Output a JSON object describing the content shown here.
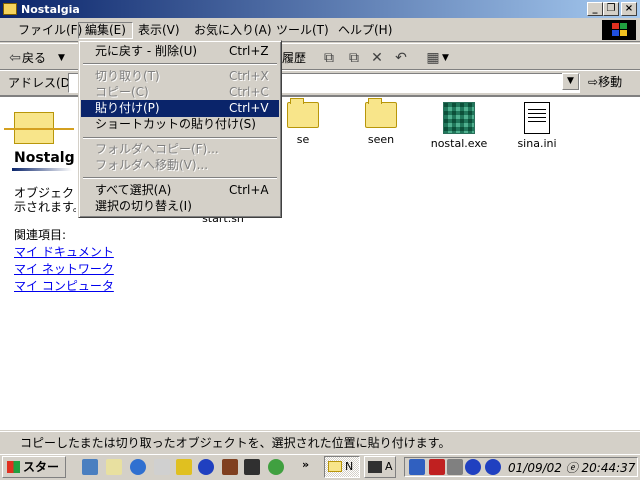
{
  "window": {
    "title": "Nostalgia"
  },
  "menubar": [
    "ファイル(F)",
    "編集(E)",
    "表示(V)",
    "お気に入り(A)",
    "ツール(T)",
    "ヘルプ(H)"
  ],
  "toolbar": {
    "back_label": "戻る",
    "history_label": "履歴"
  },
  "address": {
    "label": "アドレス(D)",
    "go_label": "移動"
  },
  "left_panel": {
    "folder_name": "Nostalg",
    "description": [
      "オブジェクトを",
      "示されます。"
    ],
    "related_label": "関連項目:",
    "links": [
      "マイ ドキュメント",
      "マイ ネットワーク",
      "マイ コンピュータ"
    ]
  },
  "files": [
    {
      "name": "se",
      "type": "folder"
    },
    {
      "name": "seen",
      "type": "folder"
    },
    {
      "name": "nostal.exe",
      "type": "exe"
    },
    {
      "name": "sina.ini",
      "type": "ini"
    },
    {
      "name": "start.sh",
      "type": "partial"
    }
  ],
  "edit_menu": [
    {
      "label": "元に戻す - 削除(U)",
      "shortcut": "Ctrl+Z",
      "state": "enabled"
    },
    {
      "label": "切り取り(T)",
      "shortcut": "Ctrl+X",
      "state": "disabled"
    },
    {
      "label": "コピー(C)",
      "shortcut": "Ctrl+C",
      "state": "disabled"
    },
    {
      "label": "貼り付け(P)",
      "shortcut": "Ctrl+V",
      "state": "highlighted"
    },
    {
      "label": "ショートカットの貼り付け(S)",
      "shortcut": "",
      "state": "enabled"
    },
    {
      "label": "フォルダへコピー(F)...",
      "shortcut": "",
      "state": "disabled"
    },
    {
      "label": "フォルダへ移動(V)...",
      "shortcut": "",
      "state": "disabled"
    },
    {
      "label": "すべて選択(A)",
      "shortcut": "Ctrl+A",
      "state": "enabled"
    },
    {
      "label": "選択の切り替え(I)",
      "shortcut": "",
      "state": "enabled"
    }
  ],
  "statusbar": {
    "text": "コピーしたまたは切り取ったオブジェクトを、選択された位置に貼り付けます。"
  },
  "taskbar": {
    "start_label": "スタート",
    "tasks": [
      "N",
      "A"
    ],
    "clock": "01/09/02 ⓔ 20:44:37"
  },
  "colors": {
    "titlebar": "#0a246a",
    "highlight": "#0a246a",
    "link": "#0000ee"
  }
}
